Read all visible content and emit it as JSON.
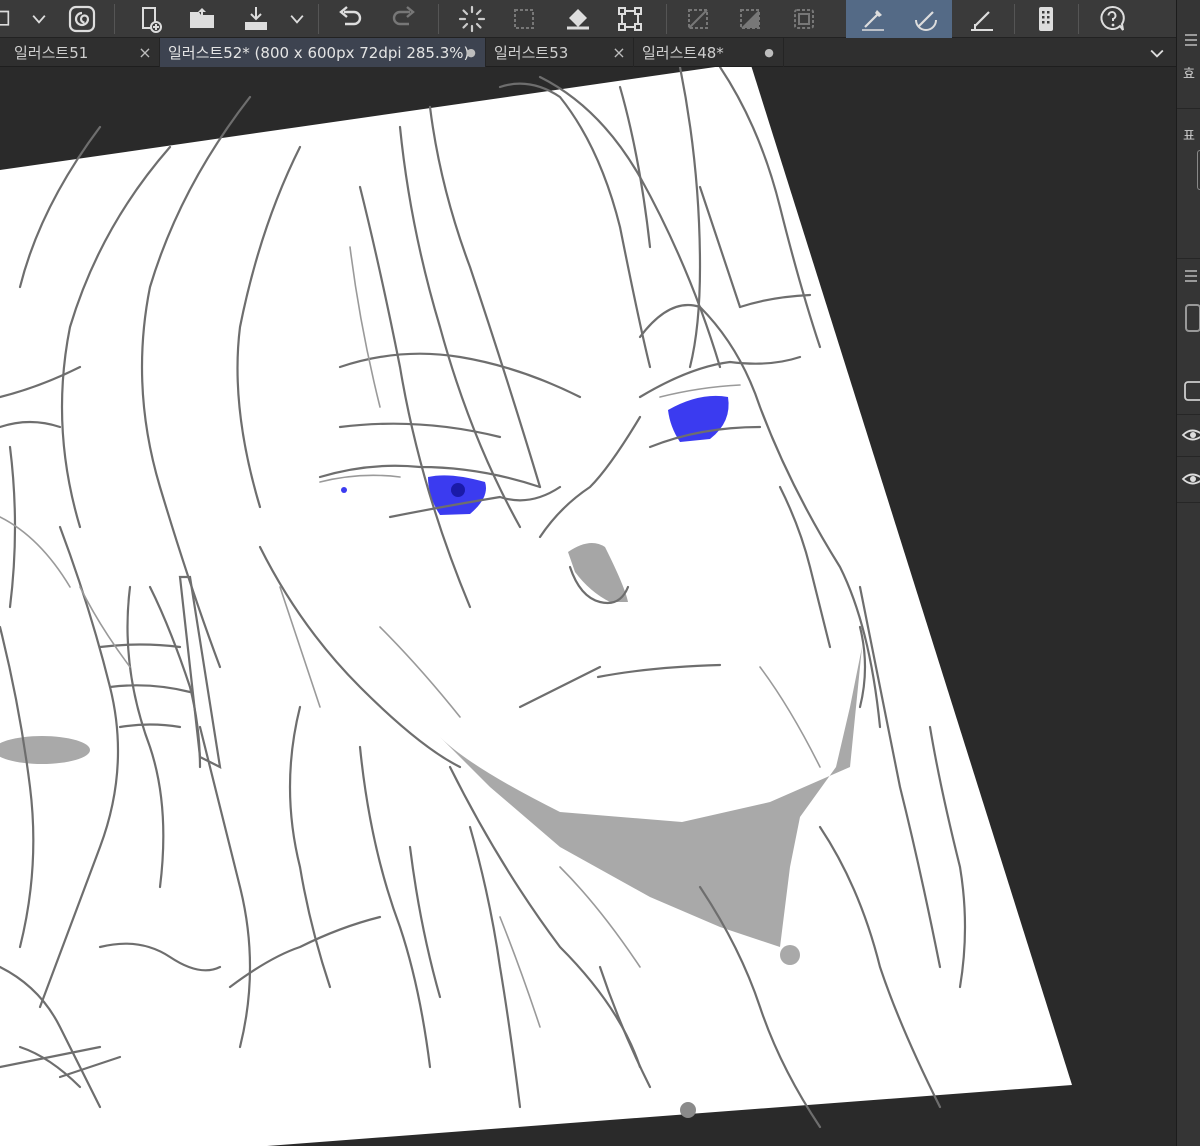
{
  "tabs": [
    {
      "label": "일러스트51",
      "control": "×"
    },
    {
      "label": "일러스트52* (800 x 600px 72dpi 285.3%)",
      "control": "●"
    },
    {
      "label": "일러스트53",
      "control": "×"
    },
    {
      "label": "일러스트48*",
      "control": "●"
    }
  ],
  "right_panel": {
    "label_1": "효",
    "label_2": "표"
  },
  "colors": {
    "toolbar_bg": "#3a3a3a",
    "active_tool": "#546a86",
    "canvas_bg": "#2a2a2a",
    "paper": "#ffffff",
    "sketch_line": "#6e6e6e",
    "shadow_fill": "#a9a9a9",
    "eye_blue": "#3b3bf0"
  },
  "icons": [
    "new-layer-icon",
    "chevron-down-icon",
    "spiral-logo-icon",
    "new-canvas-icon",
    "open-folder-icon",
    "export-icon",
    "undo-icon",
    "redo-icon",
    "loading-spinner-icon",
    "selection-icon",
    "fill-bucket-icon",
    "transform-icon",
    "eye-icon",
    "help-icon"
  ]
}
